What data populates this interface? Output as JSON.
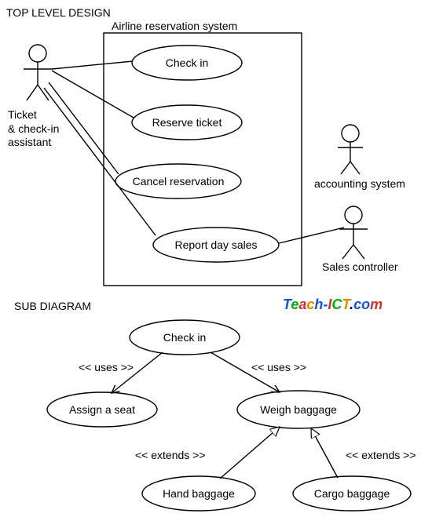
{
  "diagram": {
    "headings": {
      "top": "TOP LEVEL DESIGN",
      "sub": "SUB DIAGRAM"
    },
    "system_title": "Airline reservation system",
    "actors": {
      "assistant": "Ticket\n& check-in\nassistant",
      "accounting": "accounting system",
      "sales": "Sales controller"
    },
    "usecases": {
      "check_in": "Check in",
      "reserve": "Reserve ticket",
      "cancel": "Cancel reservation",
      "report": "Report day sales"
    },
    "sub": {
      "check_in": "Check in",
      "assign_seat": "Assign a seat",
      "weigh": "Weigh baggage",
      "hand": "Hand baggage",
      "cargo": "Cargo baggage",
      "uses": "<< uses >>",
      "extends": "<< extends >>"
    },
    "watermark": "Teach-ICT.com"
  }
}
